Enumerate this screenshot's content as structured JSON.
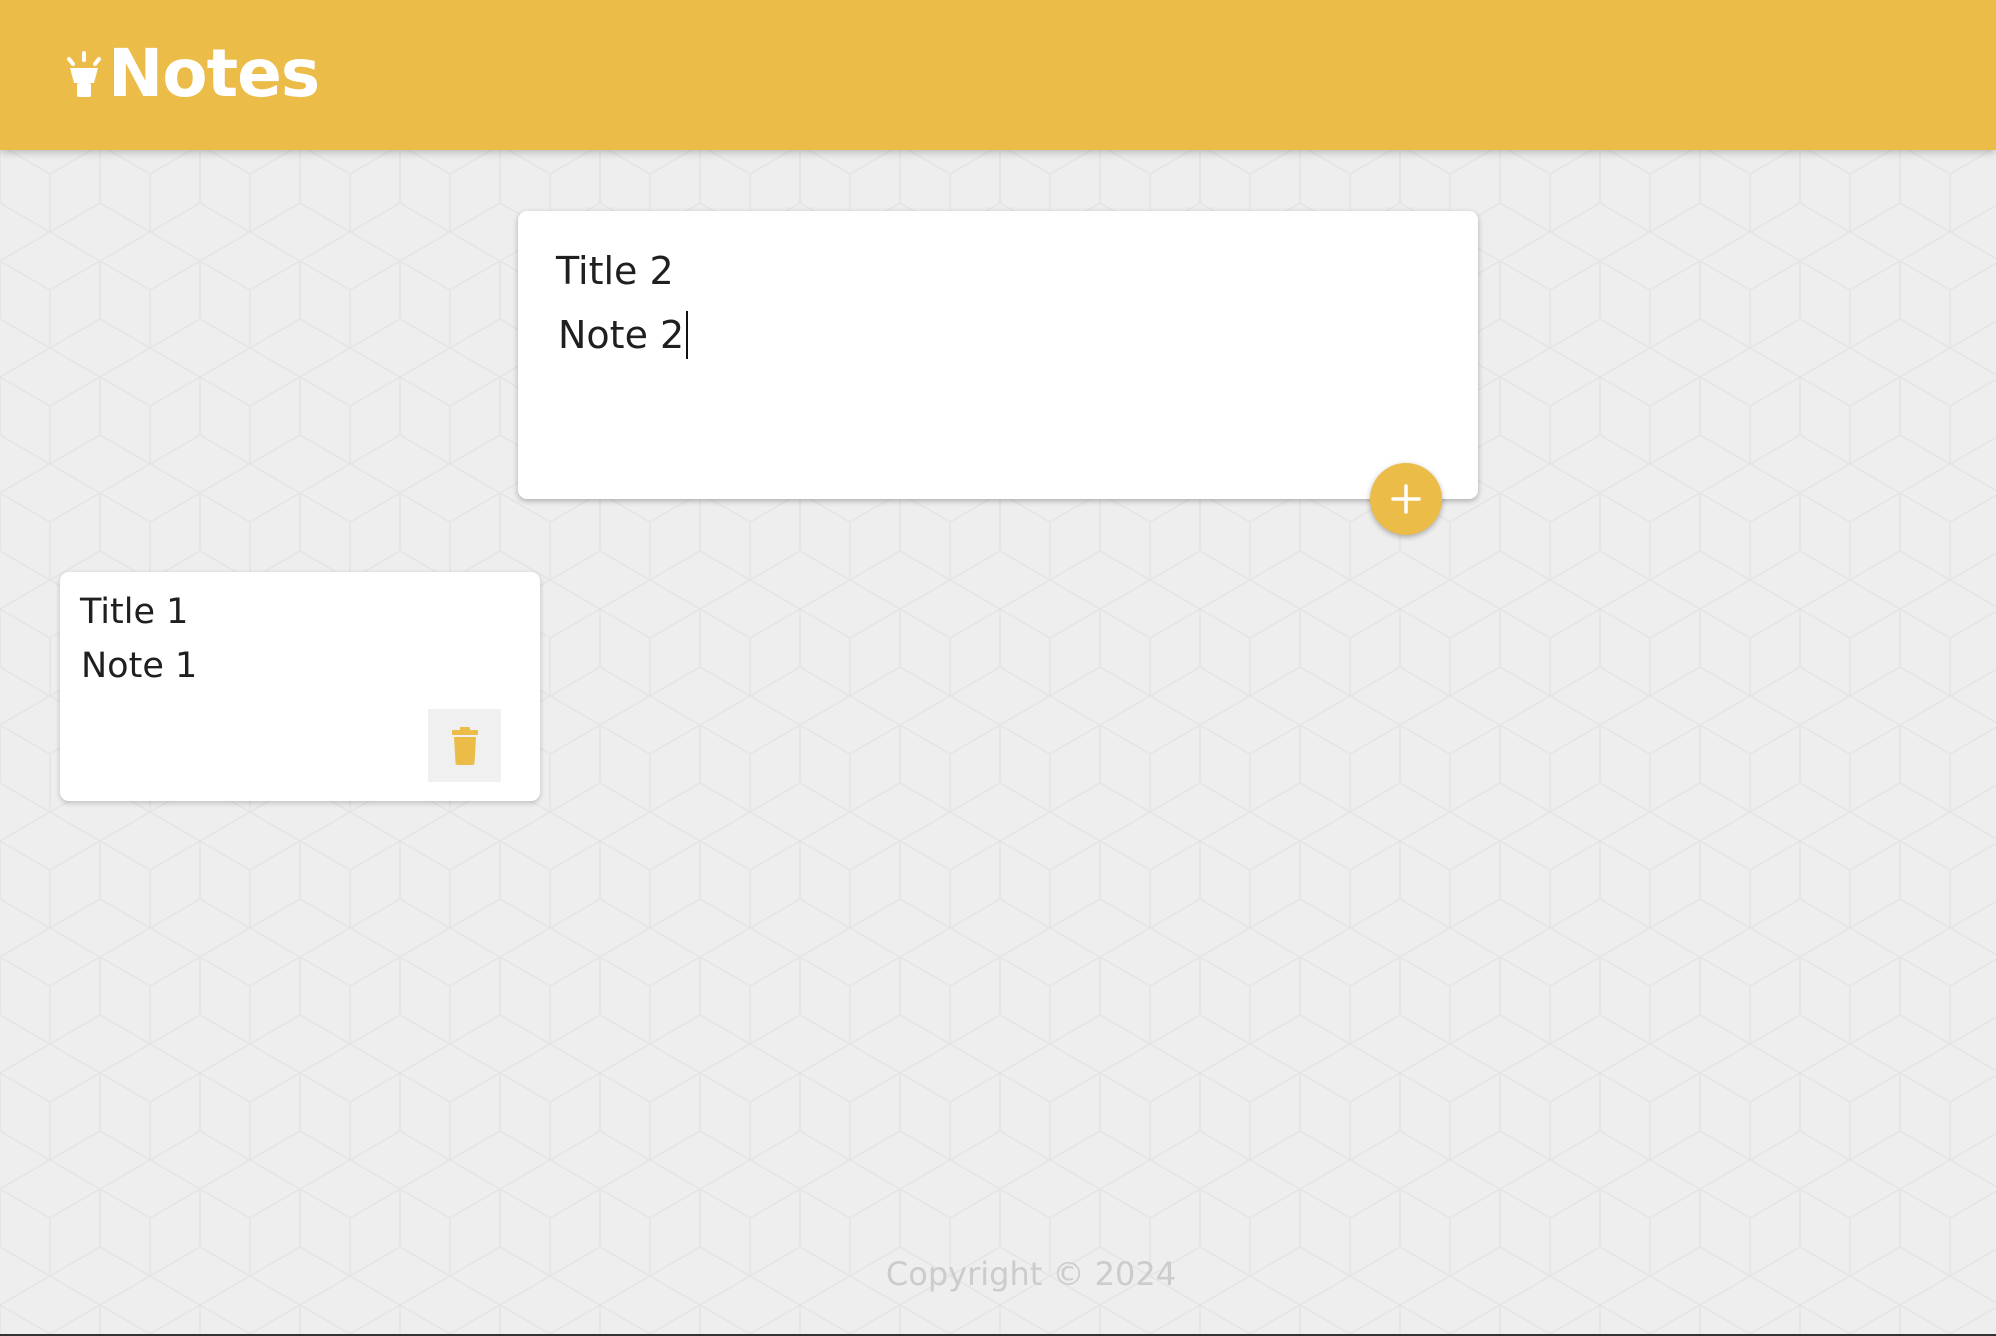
{
  "app": {
    "title": "Notes",
    "logo_icon": "lightbulb-icon",
    "accent_color": "#ebbc48",
    "background_color": "#eeeeee"
  },
  "composer": {
    "title_value": "Title 2",
    "content_value": "Note 2",
    "add_icon": "plus-icon"
  },
  "notes": [
    {
      "title": "Title 1",
      "content": "Note 1",
      "delete_icon": "trash-icon"
    }
  ],
  "footer": {
    "copyright": "Copyright © 2024"
  }
}
